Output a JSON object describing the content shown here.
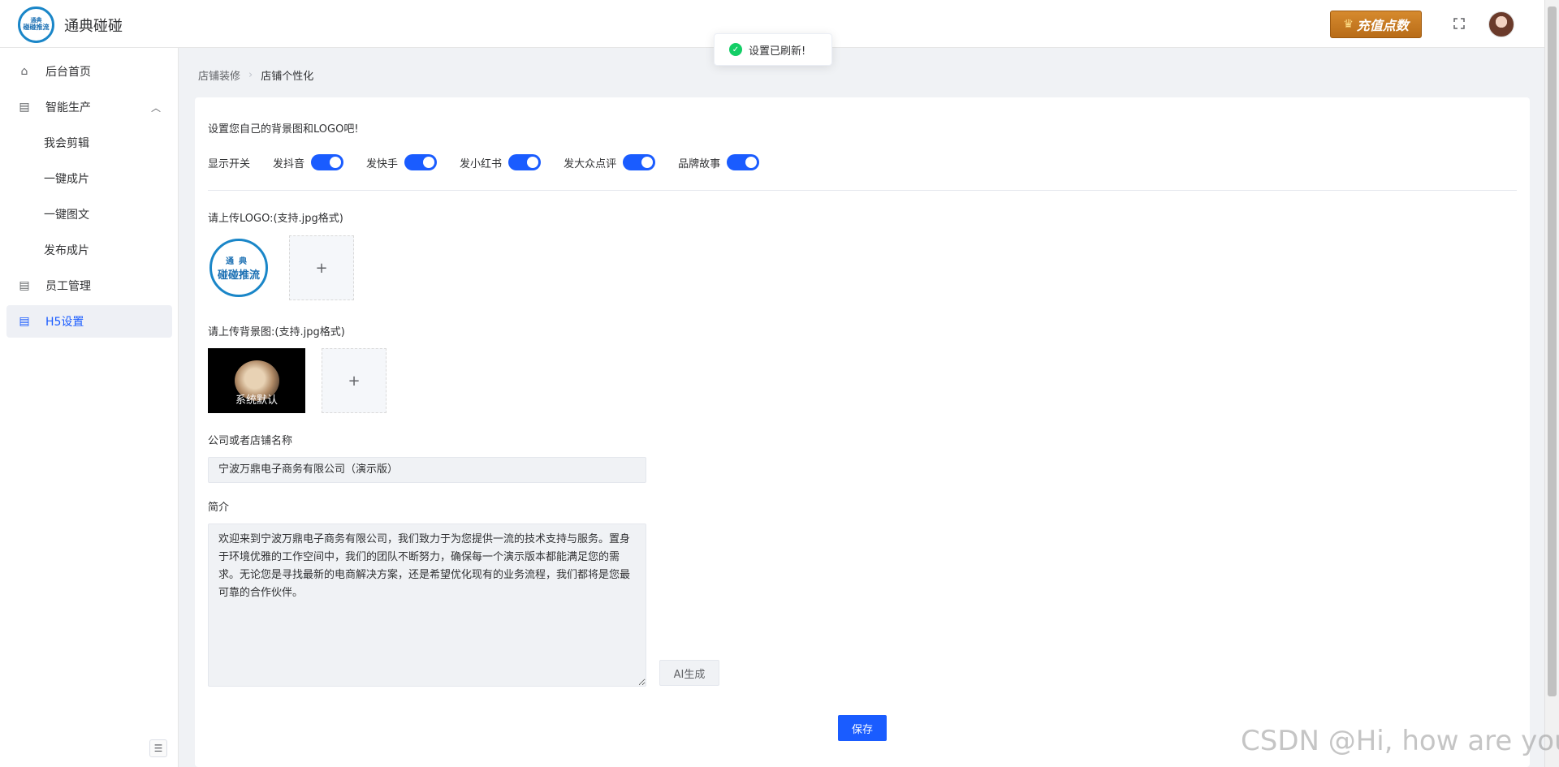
{
  "header": {
    "brand_logo_line1": "通典",
    "brand_logo_line2": "碰碰推流",
    "brand_name": "通典碰碰",
    "vip_label": "充值点数",
    "vip_badge": "VIP"
  },
  "toast": {
    "message": "设置已刷新!"
  },
  "sidebar": {
    "items": [
      {
        "label": "后台首页"
      },
      {
        "label": "智能生产"
      },
      {
        "label": "我会剪辑"
      },
      {
        "label": "一键成片"
      },
      {
        "label": "一键图文"
      },
      {
        "label": "发布成片"
      },
      {
        "label": "员工管理"
      },
      {
        "label": "H5设置"
      }
    ]
  },
  "breadcrumb": {
    "parent": "店铺装修",
    "current": "店铺个性化"
  },
  "form": {
    "intro": "设置您自己的背景图和LOGO吧!",
    "switch_label": "显示开关",
    "switches": [
      {
        "label": "发抖音",
        "on": true
      },
      {
        "label": "发快手",
        "on": true
      },
      {
        "label": "发小红书",
        "on": true
      },
      {
        "label": "发大众点评",
        "on": true
      },
      {
        "label": "品牌故事",
        "on": true
      }
    ],
    "logo_label": "请上传LOGO:(支持.jpg格式)",
    "logo_line1": "通典",
    "logo_line2": "碰碰推流",
    "bg_label": "请上传背景图:(支持.jpg格式)",
    "bg_caption": "系统默认",
    "company_label": "公司或者店铺名称",
    "company_value": "宁波万鼎电子商务有限公司（演示版）",
    "desc_label": "简介",
    "desc_value": "欢迎来到宁波万鼎电子商务有限公司，我们致力于为您提供一流的技术支持与服务。置身于环境优雅的工作空间中，我们的团队不断努力，确保每一个演示版本都能满足您的需求。无论您是寻找最新的电商解决方案，还是希望优化现有的业务流程，我们都将是您最可靠的合作伙伴。",
    "ai_label": "AI生成",
    "save_label": "保存",
    "upload_plus": "+"
  },
  "watermark": "CSDN @Hi, how are you"
}
